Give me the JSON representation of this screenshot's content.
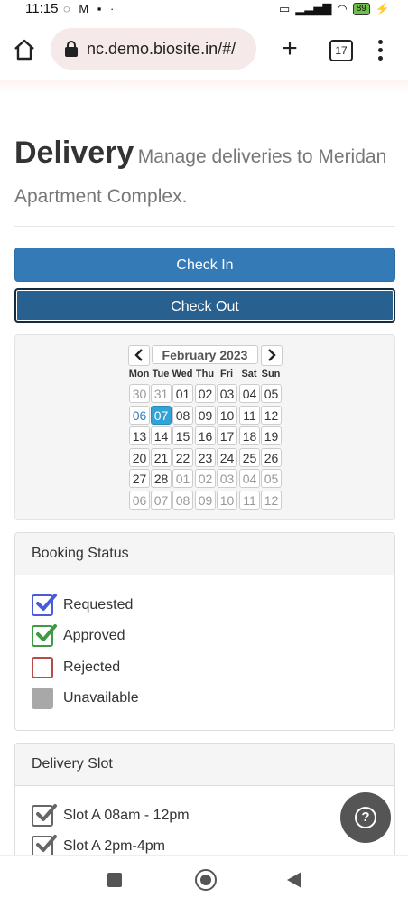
{
  "status_bar": {
    "time": "11:15",
    "battery": "89"
  },
  "browser": {
    "url": "nc.demo.biosite.in/#/",
    "tab_count": "17"
  },
  "header": {
    "title": "Delivery",
    "subtitle": "Manage deliveries to Meridan Apartment Complex."
  },
  "actions": {
    "check_in": "Check In",
    "check_out": "Check Out"
  },
  "calendar": {
    "month_label": "February 2023",
    "prev": "<",
    "next": ">",
    "weekdays": [
      "Mon",
      "Tue",
      "Wed",
      "Thu",
      "Fri",
      "Sat",
      "Sun"
    ],
    "weeks": [
      [
        "30",
        "31",
        "01",
        "02",
        "03",
        "04",
        "05"
      ],
      [
        "06",
        "07",
        "08",
        "09",
        "10",
        "11",
        "12"
      ],
      [
        "13",
        "14",
        "15",
        "16",
        "17",
        "18",
        "19"
      ],
      [
        "20",
        "21",
        "22",
        "23",
        "24",
        "25",
        "26"
      ],
      [
        "27",
        "28",
        "01",
        "02",
        "03",
        "04",
        "05"
      ],
      [
        "06",
        "07",
        "08",
        "09",
        "10",
        "11",
        "12"
      ]
    ],
    "selected_date": "07"
  },
  "booking_status": {
    "heading": "Booking Status",
    "items": [
      {
        "label": "Requested",
        "color": "#4b5bd8",
        "checked": true
      },
      {
        "label": "Approved",
        "color": "#3d9a45",
        "checked": true
      },
      {
        "label": "Rejected",
        "color": "#b94a48",
        "checked": false
      },
      {
        "label": "Unavailable",
        "color": "#a8a8a8",
        "checked": false
      }
    ]
  },
  "delivery_slot": {
    "heading": "Delivery Slot",
    "items": [
      {
        "label": "Slot A 08am - 12pm",
        "checked": true
      },
      {
        "label": "Slot A 2pm-4pm",
        "checked": true
      }
    ]
  },
  "help_button": {
    "icon": "question-icon",
    "glyph": "?"
  }
}
